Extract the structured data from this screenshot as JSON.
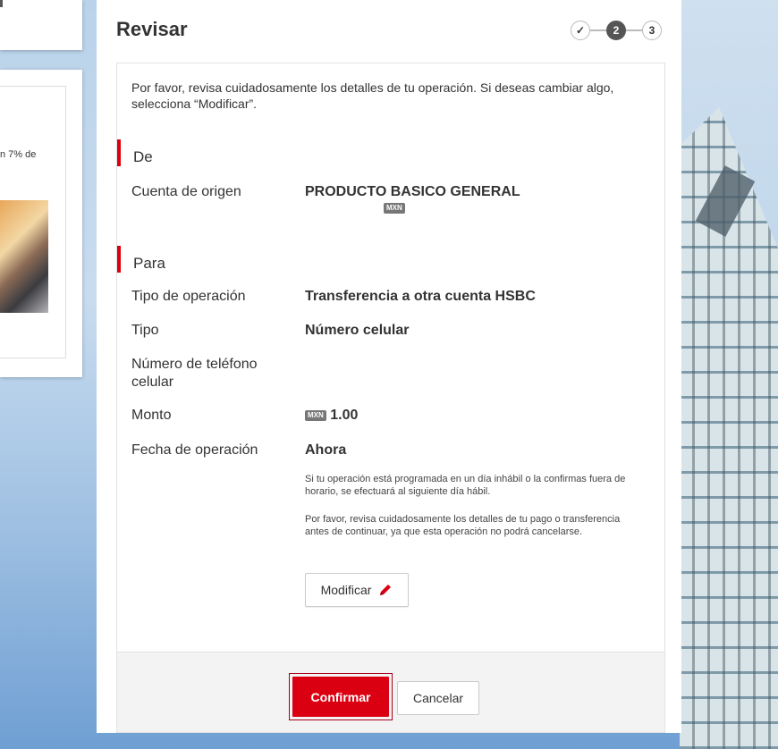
{
  "side": {
    "snippet": "n 7% de"
  },
  "header": {
    "title": "Revisar",
    "steps": [
      {
        "label": "✓",
        "state": "done"
      },
      {
        "label": "2",
        "state": "active"
      },
      {
        "label": "3",
        "state": "pending"
      }
    ]
  },
  "intro": "Por favor, revisa cuidadosamente los detalles de tu operación. Si deseas cambiar algo, selecciona “Modificar”.",
  "from": {
    "title": "De",
    "account_label": "Cuenta de origen",
    "account_value": "PRODUCTO BASICO GENERAL",
    "currency": "MXN"
  },
  "to": {
    "title": "Para",
    "op_type_label": "Tipo de operación",
    "op_type_value": "Transferencia a otra cuenta HSBC",
    "type_label": "Tipo",
    "type_value": "Número celular",
    "phone_label": "Número de teléfono celular",
    "phone_value": "",
    "amount_label": "Monto",
    "amount_currency": "MXN",
    "amount_value": "1.00",
    "date_label": "Fecha de operación",
    "date_value": "Ahora",
    "note_1": "Si tu operación está programada en un día inhábil o la confirmas fuera de horario, se efectuará al siguiente día hábil.",
    "note_2": "Por favor, revisa cuidadosamente los detalles de tu pago o transferencia antes de continuar, ya que esta operación no podrá cancelarse."
  },
  "buttons": {
    "modify": "Modificar",
    "confirm": "Confirmar",
    "cancel": "Cancelar"
  },
  "colors": {
    "brand_red": "#db0011",
    "confirm_outline": "#a8001b"
  }
}
